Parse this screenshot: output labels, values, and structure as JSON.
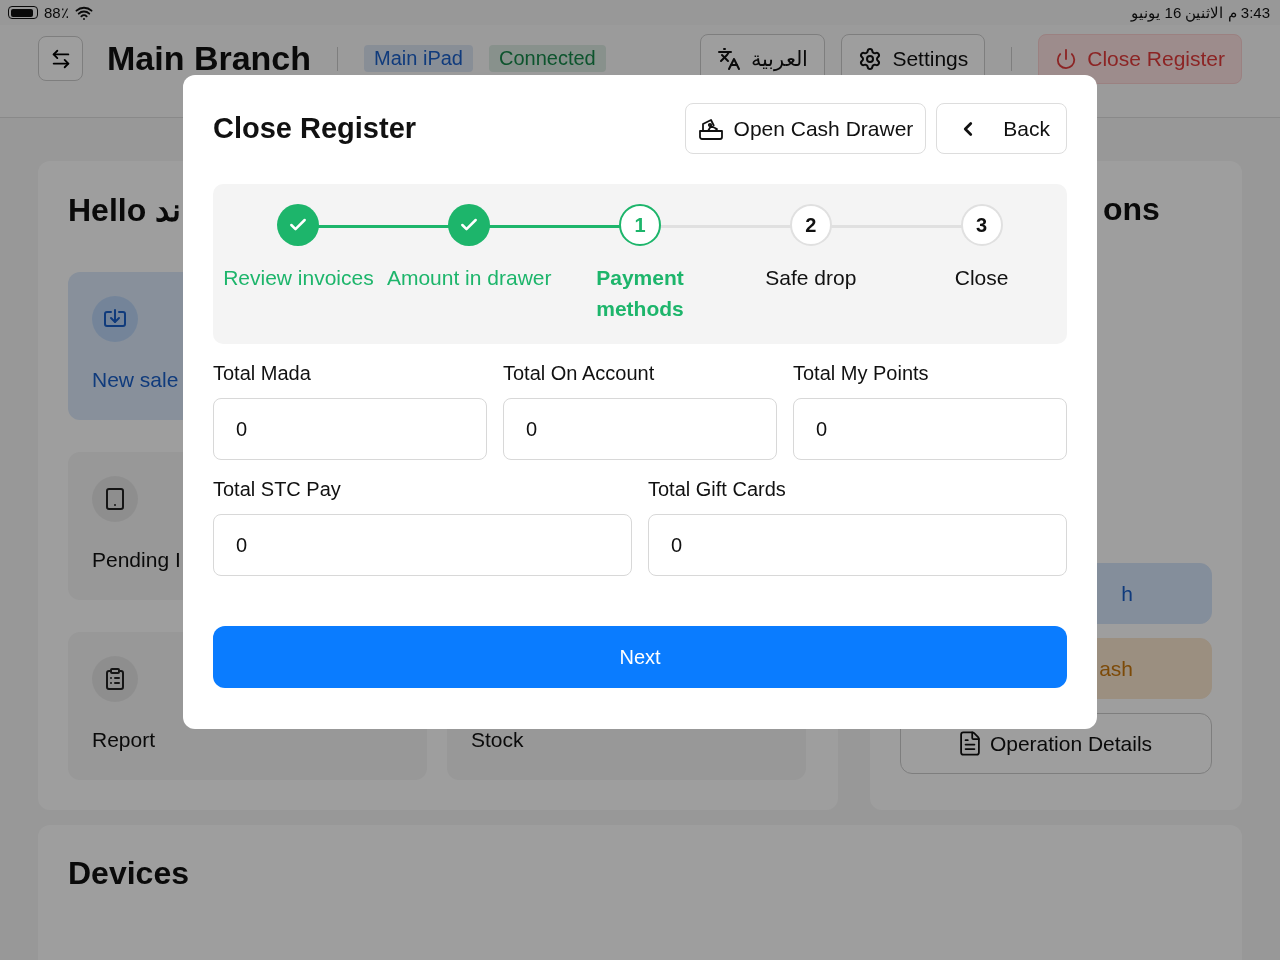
{
  "status_bar": {
    "battery": "88٪",
    "datetime": "3:43 م الاثنين 16 يونيو"
  },
  "header": {
    "title": "Main Branch",
    "badges": [
      {
        "label": "Main iPad",
        "kind": "device"
      },
      {
        "label": "Connected",
        "kind": "status"
      }
    ],
    "buttons": [
      {
        "kind": "language",
        "label": "العربية"
      },
      {
        "kind": "settings",
        "label": "Settings"
      },
      {
        "kind": "close",
        "label": "Close Register"
      }
    ]
  },
  "home": {
    "greeting": "Hello ند",
    "left_tiles": [
      {
        "kind": "sale",
        "label": "New sale",
        "selected": true
      },
      {
        "kind": "pending",
        "label": "Pending I",
        "selected": false
      },
      {
        "kind": "report",
        "label": "Report",
        "selected": false
      }
    ],
    "right_tiles": [
      {
        "label": "Stock",
        "selected": false
      }
    ],
    "operations": {
      "title": "ons",
      "buttons": [
        {
          "kind": "blue",
          "label": "h"
        },
        {
          "kind": "orange",
          "label": "ash"
        },
        {
          "kind": "outline",
          "label": "Operation Details"
        }
      ]
    },
    "devices": {
      "title": "Devices"
    }
  },
  "modal": {
    "title": "Close Register",
    "actions": [
      {
        "kind": "drawer",
        "label": "Open Cash Drawer"
      },
      {
        "kind": "back",
        "label": "Back"
      }
    ],
    "steps": [
      {
        "label": "Review invoices",
        "completed": true,
        "selected": false
      },
      {
        "label": "Amount in drawer",
        "completed": true,
        "selected": false
      },
      {
        "number": "1",
        "label": "Payment methods",
        "completed": false,
        "selected": true
      },
      {
        "number": "2",
        "label": "Safe drop",
        "completed": false,
        "selected": false
      },
      {
        "number": "3",
        "label": "Close",
        "completed": false,
        "selected": false
      }
    ],
    "field_rows": [
      [
        {
          "label": "Total Mada",
          "value": "0"
        },
        {
          "label": "Total On Account",
          "value": "0"
        },
        {
          "label": "Total My Points",
          "value": "0"
        }
      ],
      [
        {
          "label": "Total STC Pay",
          "value": "0"
        },
        {
          "label": "Total Gift Cards",
          "value": "0"
        }
      ]
    ],
    "next": "Next"
  }
}
